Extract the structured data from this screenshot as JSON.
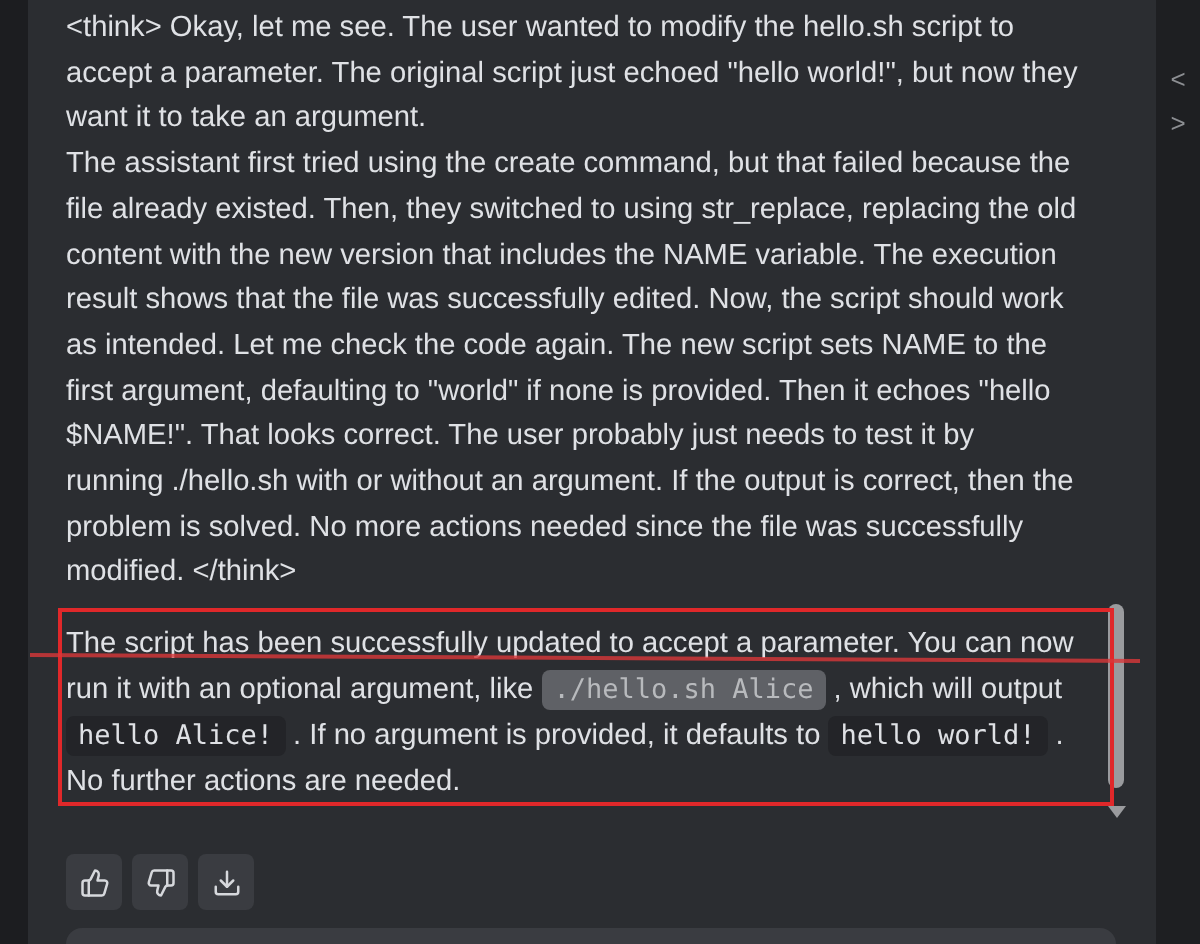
{
  "reasoning": [
    "<think> Okay, let me see. The user wanted to modify the hello.sh script to accept a parameter. The original script just echoed \"hello world!\", but now they want it to take an argument.",
    "The assistant first tried using the create command, but that failed because the file already existed. Then, they switched to using str_replace, replacing the old content with the new version that includes the NAME variable. The execution result shows that the file was successfully edited. Now, the script should work as intended. Let me check the code again. The new script sets NAME to the first argument, defaulting to \"world\" if none is provided. Then it echoes \"hello $NAME!\". That looks correct. The user probably just needs to test it by running ./hello.sh with or without an argument. If the output is correct, then the problem is solved. No more actions needed since the file was successfully modified. </think>"
  ],
  "answer": [
    {
      "kind": "text",
      "text": "The script has been successfully updated to accept a parameter. You can now run it with an optional argument, like "
    },
    {
      "kind": "code",
      "text": "./hello.sh Alice",
      "selected": true
    },
    {
      "kind": "text",
      "text": ", which will output "
    },
    {
      "kind": "code",
      "text": "hello Alice!",
      "selected": false
    },
    {
      "kind": "text",
      "text": ". If no argument is provided, it defaults to "
    },
    {
      "kind": "code",
      "text": "hello world!",
      "selected": false
    },
    {
      "kind": "text",
      "text": ". No further actions are needed."
    }
  ],
  "actions": [
    {
      "kind": "thumbs_up"
    },
    {
      "kind": "thumbs_down"
    },
    {
      "kind": "download"
    }
  ],
  "side_arrows": [
    "<",
    ">"
  ]
}
